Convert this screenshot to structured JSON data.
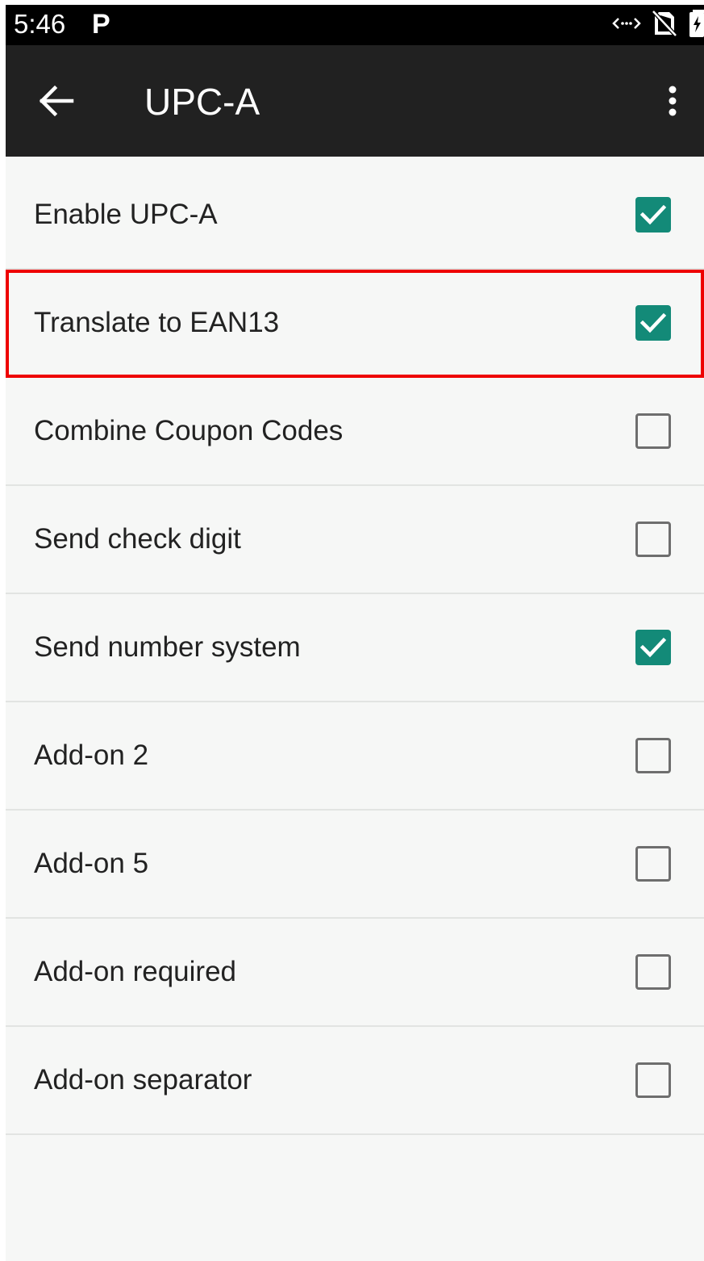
{
  "status_bar": {
    "time": "5:46",
    "notification_letter": "P",
    "icons": [
      "data-transfer-icon",
      "no-sim-icon",
      "battery-charging-icon"
    ]
  },
  "app_bar": {
    "title": "UPC-A",
    "back_icon": "arrow-back-icon",
    "menu_icon": "more-vert-icon"
  },
  "colors": {
    "checkbox_checked": "#138a78",
    "highlight_outline": "#ee0000",
    "app_bar": "#212121"
  },
  "settings": [
    {
      "label": "Enable UPC-A",
      "checked": true,
      "highlighted": false
    },
    {
      "label": "Translate to EAN13",
      "checked": true,
      "highlighted": true
    },
    {
      "label": "Combine Coupon Codes",
      "checked": false,
      "highlighted": false
    },
    {
      "label": "Send check digit",
      "checked": false,
      "highlighted": false
    },
    {
      "label": "Send number system",
      "checked": true,
      "highlighted": false
    },
    {
      "label": "Add-on 2",
      "checked": false,
      "highlighted": false
    },
    {
      "label": "Add-on 5",
      "checked": false,
      "highlighted": false
    },
    {
      "label": "Add-on required",
      "checked": false,
      "highlighted": false
    },
    {
      "label": "Add-on separator",
      "checked": false,
      "highlighted": false
    }
  ]
}
